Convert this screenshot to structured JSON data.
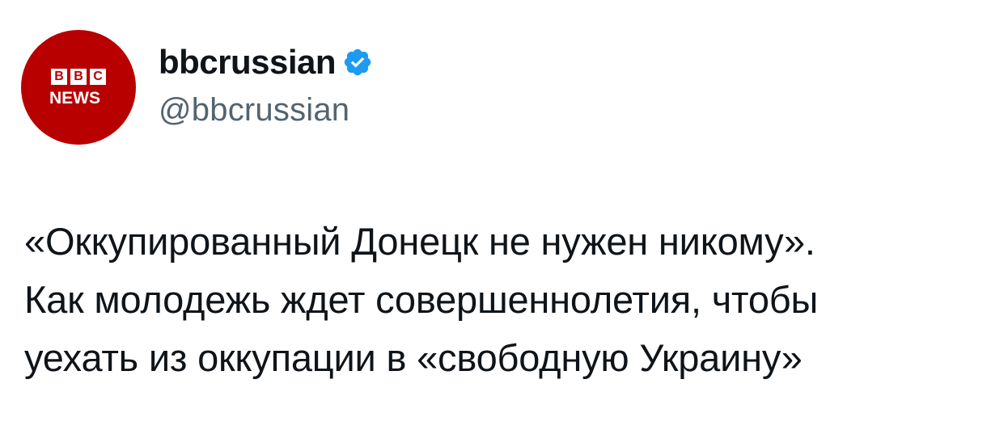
{
  "author": {
    "avatar_logo": {
      "blocks": [
        "B",
        "B",
        "C"
      ],
      "subtitle": "NEWS",
      "bg_color": "#b80000"
    },
    "display_name": "bbcrussian",
    "verified": true,
    "verified_color": "#1d9bf0",
    "handle": "@bbcrussian"
  },
  "tweet": {
    "lines": [
      "«Оккупированный Донецк не нужен никому».",
      "Как молодежь ждет совершеннолетия, чтобы",
      "уехать из оккупации в «свободную Украину»"
    ]
  }
}
